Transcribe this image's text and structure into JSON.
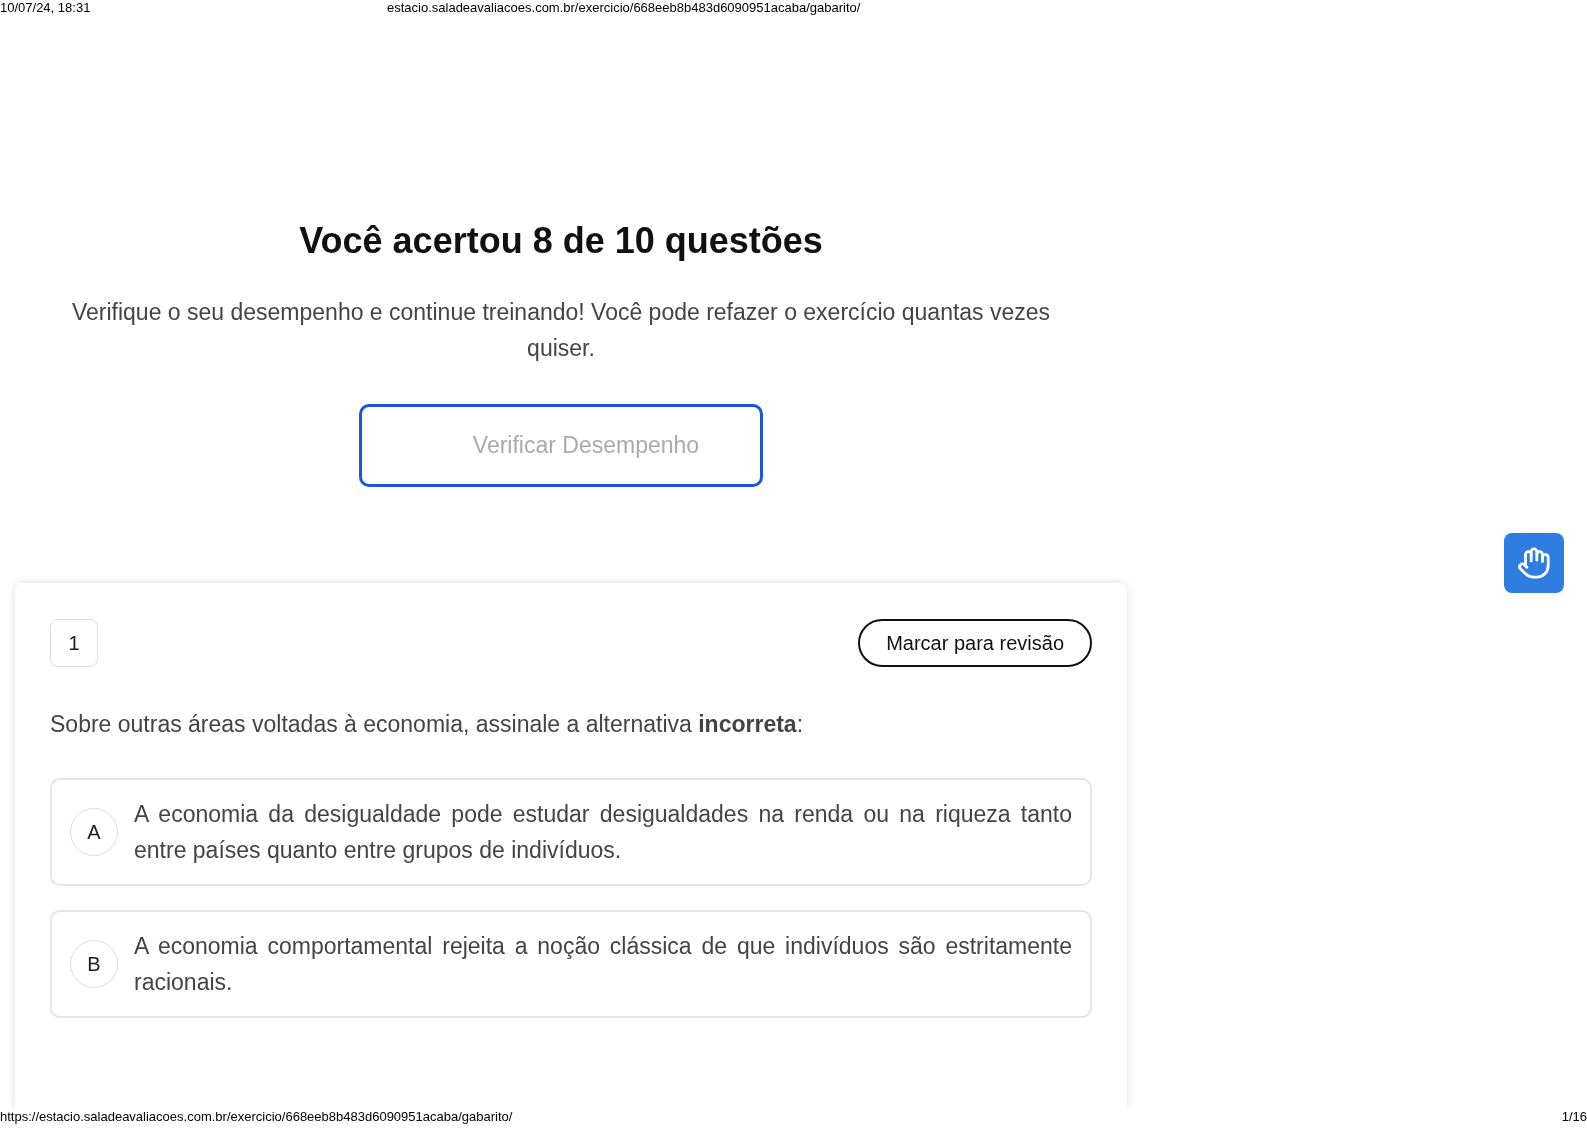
{
  "print_header": {
    "date": "10/07/24, 18:31",
    "url": "estacio.saladeavaliacoes.com.br/exercicio/668eeb8b483d6090951acaba/gabarito/"
  },
  "result": {
    "title": "Você acertou 8 de 10 questões",
    "message": "Verifique o seu desempenho e continue treinando! Você pode refazer o exercício quantas vezes quiser.",
    "button": "Verificar Desempenho"
  },
  "question": {
    "number": "1",
    "review_button": "Marcar para revisão",
    "prompt": "Sobre outras áreas voltadas à economia, assinale a alternativa **incorreta**:",
    "options": [
      {
        "letter": "A",
        "text": "A economia da desigualdade pode estudar desigualdades na renda ou na riqueza tanto entre países quanto entre grupos de indivíduos."
      },
      {
        "letter": "B",
        "text": "A economia comportamental rejeita a noção clássica de que indivíduos são estritamente racionais."
      }
    ]
  },
  "print_footer": {
    "url": "https://estacio.saladeavaliacoes.com.br/exercicio/668eeb8b483d6090951acaba/gabarito/",
    "page": "1/16"
  }
}
